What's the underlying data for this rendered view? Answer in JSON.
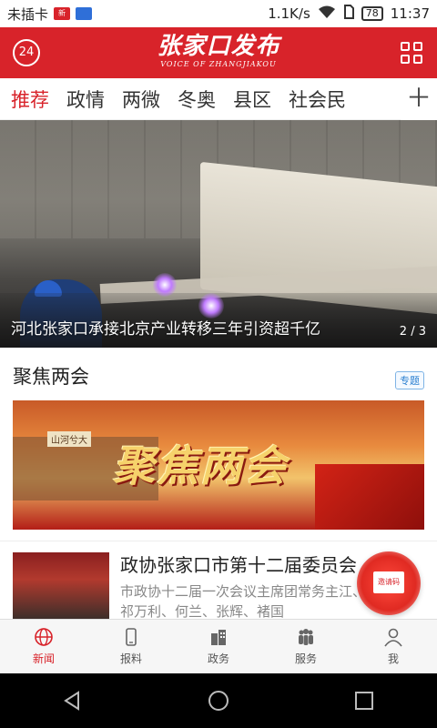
{
  "status_bar": {
    "carrier": "未插卡",
    "network_speed": "1.1K/s",
    "battery": "78",
    "time": "11:37"
  },
  "header": {
    "badge": "24",
    "logo_text": "张家口发布",
    "logo_subtitle": "VOICE OF ZHANGJIAKOU",
    "brand_color": "#d8232a"
  },
  "tabs": {
    "items": [
      "推荐",
      "政情",
      "两微",
      "冬奥",
      "县区",
      "社会民"
    ],
    "active": "推荐",
    "more": "＋"
  },
  "hero": {
    "caption": "河北张家口承接北京产业转移三年引资超千亿",
    "page_current": "2",
    "page_total": "3"
  },
  "focus": {
    "title": "聚焦两会",
    "tag": "专题",
    "banner_text": "聚焦两会",
    "banner_wall_label": "山河兮大"
  },
  "news": {
    "title": "政协张家口市第十二届委员会",
    "desc": "市政协十二届一次会议主席团常务主江、韩立友、祁万利、何兰、张辉、褚国"
  },
  "invite": {
    "label": "邀请码"
  },
  "bottom_nav": {
    "items": [
      {
        "label": "新闻",
        "icon": "globe-icon"
      },
      {
        "label": "报料",
        "icon": "phone-icon"
      },
      {
        "label": "政务",
        "icon": "building-icon"
      },
      {
        "label": "服务",
        "icon": "people-icon"
      },
      {
        "label": "我",
        "icon": "user-icon"
      }
    ],
    "active": "新闻"
  }
}
